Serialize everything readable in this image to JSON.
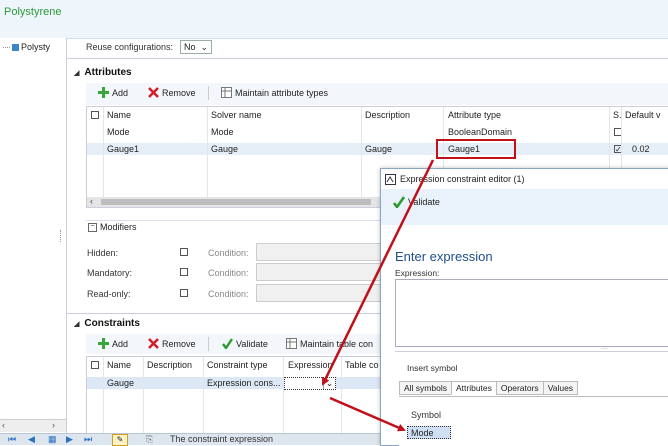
{
  "window": {
    "title": "Polystyrene"
  },
  "tree": {
    "item": "Polysty"
  },
  "reuse": {
    "label": "Reuse configurations:",
    "value": "No"
  },
  "attributes": {
    "section": "Attributes",
    "toolbar": {
      "add": "Add",
      "remove": "Remove",
      "maintain": "Maintain attribute types"
    },
    "columns": [
      "Name",
      "Solver name",
      "Description",
      "Attribute type",
      "S.",
      "Default v"
    ],
    "rows": [
      {
        "name": "Mode",
        "solver": "Mode",
        "description": "",
        "type": "BooleanDomain",
        "s": false,
        "default": ""
      },
      {
        "name": "Gauge1",
        "solver": "Gauge",
        "description": "Gauge",
        "type": "Gauge1",
        "s": true,
        "default": "0.02"
      }
    ]
  },
  "modifiers": {
    "section": "Modifiers",
    "items": [
      {
        "label": "Hidden:",
        "condition": "Condition:"
      },
      {
        "label": "Mandatory:",
        "condition": "Condition:"
      },
      {
        "label": "Read-only:",
        "condition": "Condition:"
      }
    ]
  },
  "constraints": {
    "section": "Constraints",
    "toolbar": {
      "add": "Add",
      "remove": "Remove",
      "validate": "Validate",
      "maintain": "Maintain table con"
    },
    "columns": [
      "Name",
      "Description",
      "Constraint type",
      "Expression",
      "Table co"
    ],
    "rows": [
      {
        "name": "Gauge",
        "description": "",
        "type": "Expression cons...",
        "expression": ""
      }
    ]
  },
  "editor": {
    "title": "Expression constraint editor (1)",
    "validate": "Validate",
    "heading": "Enter expression",
    "expression_label": "Expression:",
    "insert_symbol": "Insert symbol",
    "tabs": [
      "All symbols",
      "Attributes",
      "Operators",
      "Values"
    ],
    "symbol_header": "Symbol",
    "symbol_row": "Mode"
  },
  "statusbar": {
    "text": "The constraint expression"
  },
  "colors": {
    "accent": "#2a9a3a",
    "arrow": "#c0101a",
    "highlight": "#c0101a"
  }
}
